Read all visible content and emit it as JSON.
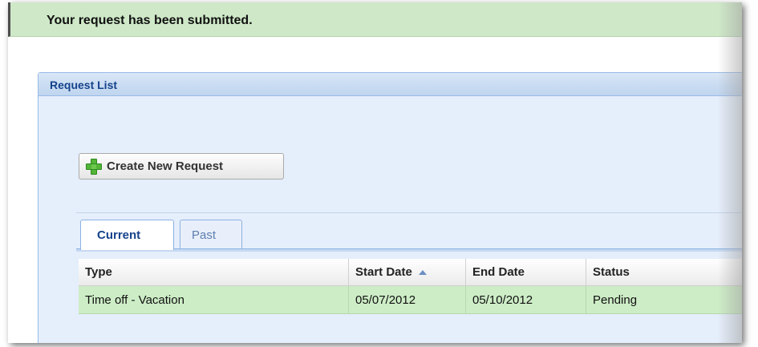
{
  "banner": {
    "message": "Your request has been submitted."
  },
  "panel": {
    "title": "Request List"
  },
  "toolbar": {
    "create_label": "Create New Request"
  },
  "tabs": [
    {
      "label": "Current",
      "active": true
    },
    {
      "label": "Past",
      "active": false
    }
  ],
  "grid": {
    "columns": [
      "Type",
      "Start Date",
      "End Date",
      "Status"
    ],
    "sort": {
      "column": "Start Date",
      "direction": "ascending"
    },
    "rows": [
      [
        "Time off - Vacation",
        "05/07/2012",
        "05/10/2012",
        "Pending"
      ]
    ]
  },
  "colors": {
    "banner_bg": "#cfe9c8",
    "panel_bg": "#e5eefb",
    "panel_title": "#15428b",
    "row_selected": "#cdedc6",
    "plus_green": "#53b538"
  },
  "icons": {
    "create": "plus-icon",
    "sort": "sort-ascending-icon"
  }
}
